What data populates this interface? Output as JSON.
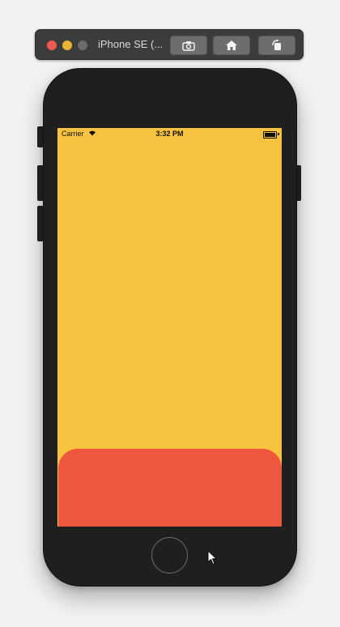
{
  "window": {
    "title": "iPhone SE (...",
    "toolbar": {
      "screenshot_icon": "camera-icon",
      "home_icon": "home-icon",
      "rotate_icon": "rotate-icon"
    }
  },
  "status_bar": {
    "carrier": "Carrier",
    "time": "3:32 PM",
    "wifi_icon": "wifi-icon",
    "battery_icon": "battery-icon"
  },
  "app": {
    "background_color": "#f7c33f",
    "sheet_color": "#ec573d"
  }
}
